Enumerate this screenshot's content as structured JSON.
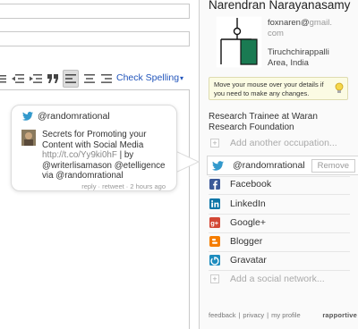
{
  "toolbar": {
    "check_spelling_label": "Check Spelling",
    "check_spelling_caret": "▾"
  },
  "sidebar": {
    "contact_name": "Narendran Narayanasamy",
    "email_line1": "foxnaren@",
    "email_domain": "gmail.",
    "email_line2": "com",
    "location_line1": "Tiruchchirappalli",
    "location_line2": "Area, India",
    "hint_text": "Move your mouse over your details if you need to make any changes.",
    "occupation": "Research Trainee at Waran Research Foundation",
    "add_occupation": "Add another occupation...",
    "twitter_handle": "@randomrational",
    "remove_label": "Remove",
    "networks": [
      {
        "label": "Facebook",
        "icon": "facebook-icon",
        "color": "#3b5998"
      },
      {
        "label": "LinkedIn",
        "icon": "linkedin-icon",
        "color": "#0e76a8"
      },
      {
        "label": "Google+",
        "icon": "google-plus-icon",
        "color": "#d34836"
      },
      {
        "label": "Blogger",
        "icon": "blogger-icon",
        "color": "#f57d00"
      },
      {
        "label": "Gravatar",
        "icon": "gravatar-icon",
        "color": "#1e8cbe"
      }
    ],
    "add_network": "Add a social network...",
    "footer": {
      "feedback": "feedback",
      "privacy": "privacy",
      "my_profile": "my profile",
      "separator": "|",
      "brand": "rapportive"
    }
  },
  "tweet": {
    "handle": "@randomrational",
    "text": "Secrets for Promoting your Content with Social Media",
    "link": "http://t.co/Yy9ki0hF",
    "by_prefix": "| by",
    "mentions": "@writerlisamason @etelligence",
    "via": "via @randomrational",
    "meta": "reply · retweet · 2 hours ago"
  },
  "colors": {
    "twitter_blue": "#3399cc",
    "link_blue": "#2255bb",
    "hint_background": "#fbfbe3",
    "avatar_green": "#1a7a52"
  }
}
